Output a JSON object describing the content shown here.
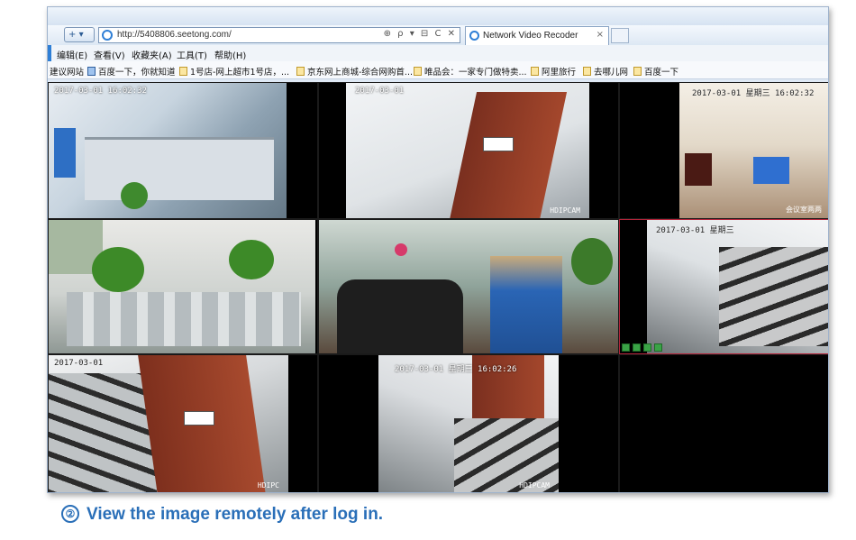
{
  "browser": {
    "url": "http://5408806.seetong.com/",
    "tab_title": "Network Video Recoder",
    "nav_glyph": "+",
    "addr_tools": "⊕ ρ ▾ ⊟ C ✕",
    "tab_close": "×",
    "menu": [
      "编辑(E)",
      "查看(V)",
      "收藏夹(A)",
      "工具(T)",
      "帮助(H)"
    ],
    "favorites": [
      {
        "label": "建议网站",
        "icon": "none"
      },
      {
        "label": "百度一下，你就知道",
        "icon": "blue"
      },
      {
        "label": "1号店-网上超市1号店，...",
        "icon": "page"
      },
      {
        "label": "京东网上商城-综合网购首...",
        "icon": "page"
      },
      {
        "label": "唯品会：一家专门做特卖...",
        "icon": "page"
      },
      {
        "label": "阿里旅行",
        "icon": "page"
      },
      {
        "label": "去哪儿网",
        "icon": "page"
      },
      {
        "label": "百度一下",
        "icon": "page"
      }
    ]
  },
  "cameras": [
    {
      "id": "cam-1",
      "timestamp": "2017-03-01  16:02:32",
      "watermark": "",
      "selected": false
    },
    {
      "id": "cam-2",
      "timestamp": "2017-03-01",
      "watermark": "HDIPCAM",
      "selected": false
    },
    {
      "id": "cam-3",
      "timestamp": "2017-03-01  星期三  16:02:32",
      "watermark": "会议室两两",
      "selected": false
    },
    {
      "id": "cam-4",
      "timestamp": "",
      "watermark": "",
      "selected": false
    },
    {
      "id": "cam-5",
      "timestamp": "",
      "watermark": "",
      "selected": false
    },
    {
      "id": "cam-6",
      "timestamp": "2017-03-01  星期三",
      "watermark": "",
      "selected": true
    },
    {
      "id": "cam-7",
      "timestamp": "2017-03-01",
      "watermark": "HDIPC",
      "selected": false
    },
    {
      "id": "cam-8",
      "timestamp": "2017-03-01  星期三  16:02:26",
      "watermark": "HDIPCAM",
      "selected": false
    },
    {
      "id": "cam-9",
      "timestamp": "",
      "watermark": "",
      "selected": false
    }
  ],
  "caption": {
    "number": "②",
    "text": "View the image remotely after log in."
  },
  "colors": {
    "accent": "#2a6fb8",
    "selected_border": "#b2243a",
    "control_green": "#3aa346"
  }
}
